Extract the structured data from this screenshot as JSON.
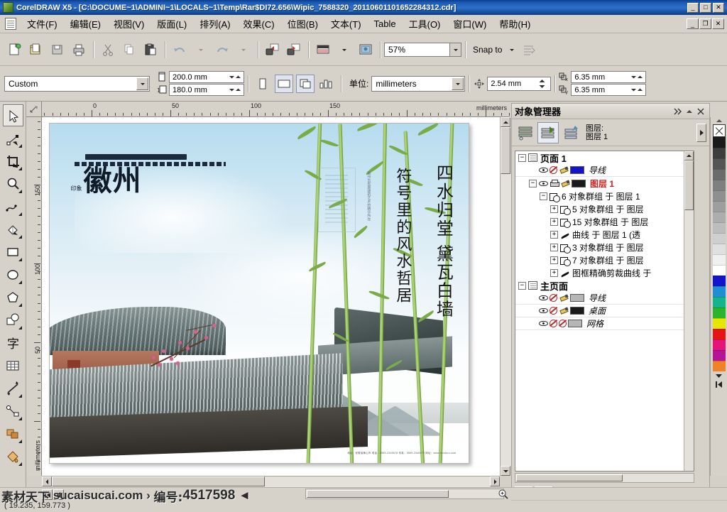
{
  "window": {
    "title": "CorelDRAW X5 - [C:\\DOCUME~1\\ADMINI~1\\LOCALS~1\\Temp\\Rar$DI72.656\\Wipic_7588320_20110601101652284312.cdr]",
    "app_icon": "corel-app-icon",
    "minimize": "_",
    "maximize": "□",
    "close": "✕",
    "mdi_minimize": "_",
    "mdi_restore": "❐",
    "mdi_close": "✕"
  },
  "menu": {
    "doc_icon": "document-icon",
    "items": [
      {
        "name": "file",
        "label": "文件(F)"
      },
      {
        "name": "edit",
        "label": "编辑(E)"
      },
      {
        "name": "view",
        "label": "视图(V)"
      },
      {
        "name": "layout",
        "label": "版面(L)"
      },
      {
        "name": "arrange",
        "label": "排列(A)"
      },
      {
        "name": "effects",
        "label": "效果(C)"
      },
      {
        "name": "bitmap",
        "label": "位图(B)"
      },
      {
        "name": "text",
        "label": "文本(T)"
      },
      {
        "name": "table",
        "label": "Table"
      },
      {
        "name": "tools",
        "label": "工具(O)"
      },
      {
        "name": "window",
        "label": "窗口(W)"
      },
      {
        "name": "help",
        "label": "帮助(H)"
      }
    ]
  },
  "toolbar_standard": {
    "buttons": [
      {
        "name": "new-document-button",
        "icon": "new-document-icon"
      },
      {
        "name": "open-document-button",
        "icon": "open-folder-icon"
      },
      {
        "name": "save-document-button",
        "icon": "save-disk-icon"
      },
      {
        "name": "print-button",
        "icon": "printer-icon"
      },
      {
        "name": "cut-button",
        "icon": "scissors-icon"
      },
      {
        "name": "copy-button",
        "icon": "copy-icon"
      },
      {
        "name": "paste-button",
        "icon": "clipboard-paste-icon"
      },
      {
        "name": "undo-button",
        "icon": "undo-arrow-icon"
      },
      {
        "name": "redo-button",
        "icon": "redo-arrow-icon"
      },
      {
        "name": "import-button",
        "icon": "import-icon"
      },
      {
        "name": "export-button",
        "icon": "export-icon"
      },
      {
        "name": "application-launcher-button",
        "icon": "app-launcher-icon"
      },
      {
        "name": "corel-online-button",
        "icon": "corel-online-icon"
      }
    ],
    "zoom_level": "57%",
    "zoom_dropdown_icon": "chevron-down-icon",
    "snap_to_label": "Snap to",
    "snap_dropdown_icon": "chevron-down-icon",
    "options_icon": "options-icon"
  },
  "property_bar": {
    "paper_type": "Custom",
    "paper_dropdown_icon": "chevron-down-icon",
    "page_width": "200.0 mm",
    "page_height": "180.0 mm",
    "width_icon": "page-width-icon",
    "height_icon": "page-height-icon",
    "orientation_portrait": "portrait-icon",
    "orientation_landscape": "landscape-icon",
    "page_all_icon": "all-pages-icon",
    "page_current_icon": "current-page-icon",
    "units_label": "单位:",
    "units_value": "millimeters",
    "units_dropdown_icon": "chevron-down-icon",
    "nudge_icon": "nudge-offset-icon",
    "nudge_value": "2.54 mm",
    "duplicate_x_icon": "duplicate-x-icon",
    "duplicate_x": "6.35 mm",
    "duplicate_y_icon": "duplicate-y-icon",
    "duplicate_y": "6.35 mm"
  },
  "toolbox": [
    {
      "name": "pick-tool",
      "icon": "arrow-cursor-icon",
      "active": true,
      "flyout": false
    },
    {
      "name": "shape-tool",
      "icon": "shape-node-icon",
      "active": false,
      "flyout": true
    },
    {
      "name": "crop-tool",
      "icon": "crop-icon",
      "active": false,
      "flyout": true
    },
    {
      "name": "zoom-tool",
      "icon": "magnifier-icon",
      "active": false,
      "flyout": true
    },
    {
      "name": "freehand-tool",
      "icon": "freehand-pen-icon",
      "active": false,
      "flyout": true
    },
    {
      "name": "smart-fill-tool",
      "icon": "smart-fill-icon",
      "active": false,
      "flyout": true
    },
    {
      "name": "rectangle-tool",
      "icon": "rectangle-icon",
      "active": false,
      "flyout": true
    },
    {
      "name": "ellipse-tool",
      "icon": "ellipse-icon",
      "active": false,
      "flyout": true
    },
    {
      "name": "polygon-tool",
      "icon": "polygon-icon",
      "active": false,
      "flyout": true
    },
    {
      "name": "basic-shapes-tool",
      "icon": "basic-shapes-icon",
      "active": false,
      "flyout": true
    },
    {
      "name": "text-tool",
      "icon": "text-a-icon",
      "active": false,
      "flyout": false
    },
    {
      "name": "table-tool",
      "icon": "table-grid-icon",
      "active": false,
      "flyout": false
    },
    {
      "name": "dimension-tool",
      "icon": "dimension-line-icon",
      "active": false,
      "flyout": true
    },
    {
      "name": "connector-tool",
      "icon": "connector-icon",
      "active": false,
      "flyout": true
    },
    {
      "name": "blend-tool",
      "icon": "blend-icon",
      "active": false,
      "flyout": true
    },
    {
      "name": "fill-tool",
      "icon": "paint-bucket-icon",
      "active": false,
      "flyout": true
    }
  ],
  "rulers": {
    "horizontal_ticks": [
      "0",
      "50",
      "100",
      "150"
    ],
    "horizontal_unit": "millimeters",
    "vertical_ticks": [
      "150",
      "100",
      "50"
    ],
    "vertical_unit": "millimeters",
    "corner_icon": "ruler-origin-icon"
  },
  "artwork": {
    "brand_seal": "印象",
    "brand_title": "徽州",
    "vertical_line_1": "四水归堂  黛瓦白墙",
    "vertical_line_2": "符号里的风水哲居",
    "vertical_tiny": "徽州古民居建筑艺术的精华所在",
    "footer_note": "地址：安徽省黄山市  电话：0559-2345678  传真：0559-2345679  网址：www.huizhou.com"
  },
  "docker": {
    "title": "对象管理器",
    "expand_icon": "chevron-double-right-icon",
    "collapse_icon": "chevron-up-icon",
    "close_icon": "close-icon",
    "tool_buttons": [
      {
        "name": "show-object-properties-button",
        "icon": "object-properties-icon",
        "selected": false
      },
      {
        "name": "edit-across-layers-button",
        "icon": "edit-across-layers-icon",
        "selected": true
      },
      {
        "name": "layer-manager-view-button",
        "icon": "layer-manager-icon",
        "selected": false
      }
    ],
    "layer_label_line1": "图层:",
    "layer_label_line2": "图层 1",
    "options_icon": "flyout-arrow-icon",
    "tree": [
      {
        "name": "tree-row-page-1",
        "depth": 0,
        "expander": "−",
        "icon": "page-icon",
        "label": "页面 1",
        "style": "bold",
        "swatch": null
      },
      {
        "name": "tree-row-guides",
        "depth": 1,
        "expander": null,
        "icon": "visibility-print-edit",
        "label": "导线",
        "style": "italic",
        "swatch": "#1414c8"
      },
      {
        "name": "tree-row-layer-1",
        "depth": 1,
        "expander": "−",
        "icon": "visibility-print-edit",
        "label": "图层 1",
        "style": "red",
        "swatch": "#1a1a1a"
      },
      {
        "name": "tree-row-group-6",
        "depth": 2,
        "expander": "−",
        "icon": "group-icon",
        "label": "6 对象群组 于 图层 1",
        "style": "normal",
        "swatch": null
      },
      {
        "name": "tree-row-group-5",
        "depth": 3,
        "expander": "+",
        "icon": "group-icon",
        "label": "5 对象群组 于 图层",
        "style": "normal",
        "swatch": null
      },
      {
        "name": "tree-row-group-15",
        "depth": 3,
        "expander": "+",
        "icon": "group-icon",
        "label": "15 对象群组 于 图层",
        "style": "normal",
        "swatch": null
      },
      {
        "name": "tree-row-curve",
        "depth": 3,
        "expander": "+",
        "icon": "curve-icon",
        "label": "曲线 于 图层 1  (透",
        "style": "normal",
        "swatch": null
      },
      {
        "name": "tree-row-group-3",
        "depth": 3,
        "expander": "+",
        "icon": "group-icon",
        "label": "3 对象群组 于 图层",
        "style": "normal",
        "swatch": null
      },
      {
        "name": "tree-row-group-7",
        "depth": 3,
        "expander": "+",
        "icon": "group-icon",
        "label": "7 对象群组 于 图层",
        "style": "normal",
        "swatch": null
      },
      {
        "name": "tree-row-powerclip-curve",
        "depth": 3,
        "expander": "+",
        "icon": "curve-icon",
        "label": "图框精确剪裁曲线 于",
        "style": "normal",
        "swatch": null
      },
      {
        "name": "tree-row-master-page",
        "depth": 0,
        "expander": "−",
        "icon": "page-icon",
        "label": "主页面",
        "style": "bold",
        "swatch": null
      },
      {
        "name": "tree-row-master-guides",
        "depth": 1,
        "expander": null,
        "icon": "visibility-print-edit",
        "label": "导线",
        "style": "italic",
        "swatch": "#b6b6b6"
      },
      {
        "name": "tree-row-desktop",
        "depth": 1,
        "expander": null,
        "icon": "visibility-print-edit",
        "label": "桌面",
        "style": "italic",
        "swatch": "#1a1a1a"
      },
      {
        "name": "tree-row-grid",
        "depth": 1,
        "expander": null,
        "icon": "visibility-print-edit",
        "label": "网格",
        "style": "italic",
        "swatch": "#b6b6b6"
      }
    ],
    "footer_buttons": [
      {
        "name": "new-layer-button",
        "icon": "new-layer-icon"
      },
      {
        "name": "new-master-layer-button",
        "icon": "new-master-layer-icon"
      }
    ]
  },
  "palette": {
    "no_color_icon": "no-color-x-icon",
    "scroll_up_icon": "chevron-up-icon",
    "scroll_down_icon": "chevron-down-icon",
    "expand_icon": "palette-expand-icon",
    "colors": [
      "#1a1a1a",
      "#3d3d3d",
      "#555555",
      "#6b6b6b",
      "#7f7f7f",
      "#8f8f8f",
      "#9e9e9e",
      "#adadad",
      "#bdbdbd",
      "#cfcfcf",
      "#e0e0e0",
      "#f0f0f0",
      "#ffffff",
      "#1414c8",
      "#1e90d2",
      "#14b48c",
      "#2db42d",
      "#e6e600",
      "#e61414",
      "#e61478",
      "#b41496",
      "#f08228"
    ]
  },
  "statusbar": {
    "coords": "( 19.235, 159.773 )",
    "cursor_icon": "arrow-cursor-icon",
    "page_first_icon": "first-page-icon",
    "page_prev_icon": "prev-page-icon",
    "page_next_icon": "next-page-icon",
    "page_last_icon": "last-page-icon",
    "zoom_icon": "magnifier-icon"
  },
  "watermark": {
    "site_zh": "素材天下",
    "site_en": "sucaisucai.com",
    "sep": "›",
    "id_label": "编号:",
    "id_value": "4517598",
    "arrow": "◄"
  }
}
